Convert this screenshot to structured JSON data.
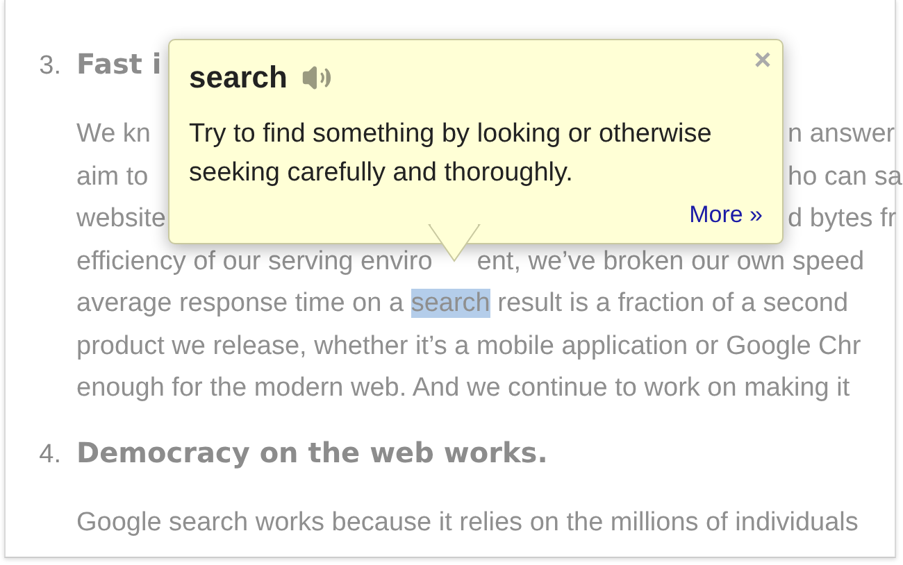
{
  "sections": [
    {
      "number": "3.",
      "heading": "Fast i",
      "lines": [
        {
          "kind": "split",
          "left": "We kn",
          "right": "n answer"
        },
        {
          "kind": "split",
          "left": "aim to",
          "right": "ho can sa"
        },
        {
          "kind": "split",
          "left": "website",
          "right": "d bytes fr"
        },
        {
          "kind": "pointer",
          "left": "efficiency of our serving enviro",
          "right": "ent, we’ve broken our own speed"
        },
        {
          "kind": "highlight",
          "parts": [
            {
              "text": "average response time on a ",
              "selected": false
            },
            {
              "text": "search",
              "selected": true
            },
            {
              "text": " result is a fraction of a second",
              "selected": false
            }
          ]
        },
        {
          "kind": "plain",
          "text": "product we release, whether it’s a mobile application or Google Chr"
        },
        {
          "kind": "plain",
          "text": "enough for the modern web. And we continue to work on making it"
        }
      ]
    },
    {
      "number": "4.",
      "heading": "Democracy on the web works.",
      "lines": [
        {
          "kind": "plain",
          "text": "Google search works because it relies on the millions of individuals"
        }
      ]
    }
  ],
  "popup": {
    "word": "search",
    "definition": "Try to find something by looking or otherwise seeking carefully and thoroughly.",
    "link": "More »"
  }
}
